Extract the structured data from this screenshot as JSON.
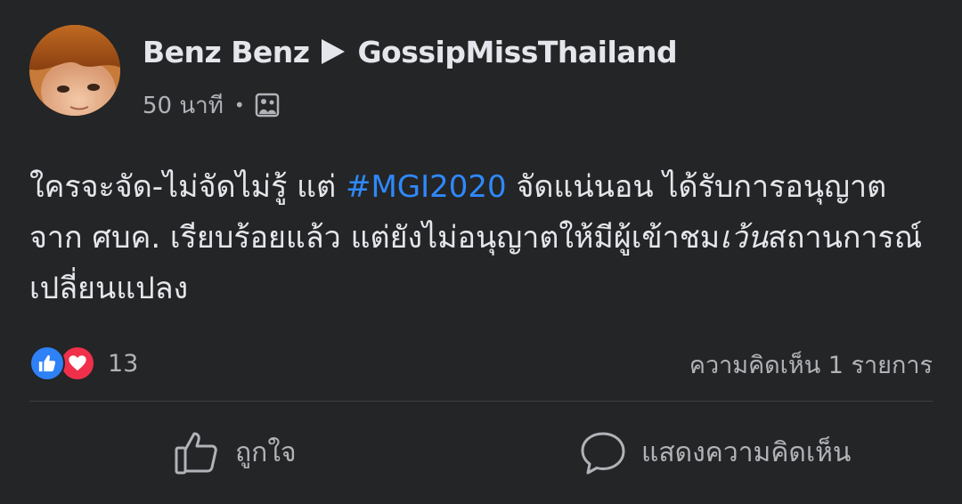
{
  "post": {
    "author": "Benz Benz",
    "group": "GossipMissThailand",
    "time": "50 นาที",
    "separator": "•",
    "privacy_icon": "photo-icon",
    "text_part1": "ใครจะจัด-ไม่จัดไม่รู้ แต่ ",
    "hashtag": "#MGI2020",
    "text_part2": " จัดแน่นอน ได้รับการอนุญาตจาก ศบค. เรียบร้อยแล้ว แต่ยังไม่อนุญาตให้มีผู้เข้าชม",
    "text_italic": "เว้น",
    "text_part3": "สถานการณ์เปลี่ยนแปลง"
  },
  "reactions": {
    "icons": [
      "like-icon",
      "love-icon"
    ],
    "count": "13",
    "comments": "ความคิดเห็น 1 รายการ"
  },
  "actions": {
    "like_label": "ถูกใจ",
    "comment_label": "แสดงความคิดเห็น"
  },
  "colors": {
    "background": "#242526",
    "text": "#e4e6eb",
    "secondary_text": "#b0b3b8",
    "hashtag": "#2e89ff",
    "like": "#2e81f7",
    "love": "#f0304b"
  }
}
